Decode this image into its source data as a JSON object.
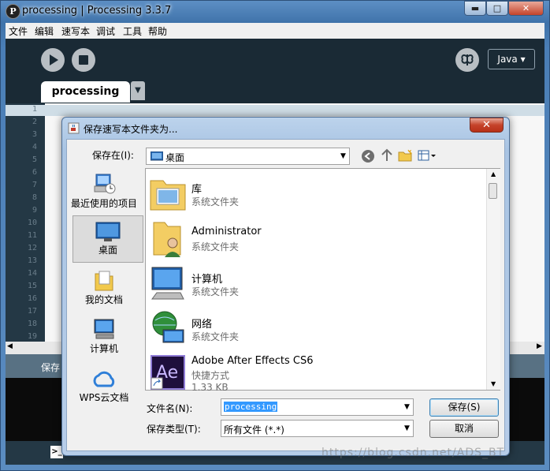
{
  "window": {
    "title": "processing | Processing 3.3.7",
    "app_icon_letter": "P",
    "minimize": "▬",
    "maximize": "□",
    "close": "✕"
  },
  "menu": [
    "文件",
    "编辑",
    "速写本",
    "调试",
    "工具",
    "帮助"
  ],
  "toolbar": {
    "mode_label": "Java ▾",
    "debug_glyph": "꙰"
  },
  "tab": {
    "label": "processing",
    "menu_arrow": "▼"
  },
  "line_numbers": [
    "1",
    "2",
    "3",
    "4",
    "5",
    "6",
    "7",
    "8",
    "9",
    "10",
    "11",
    "12",
    "13",
    "14",
    "15",
    "16",
    "17",
    "18",
    "19"
  ],
  "status_text": "保存",
  "dialog": {
    "title": "保存速写本文件夹为...",
    "close": "✕",
    "save_in_label": "保存在(I):",
    "save_in_value": "桌面",
    "places": [
      {
        "label": "最近使用的项目",
        "icon": "recent-icon"
      },
      {
        "label": "桌面",
        "icon": "desktop-icon"
      },
      {
        "label": "我的文档",
        "icon": "documents-icon"
      },
      {
        "label": "计算机",
        "icon": "computer-icon"
      },
      {
        "label": "WPS云文档",
        "icon": "cloud-icon"
      }
    ],
    "files": [
      {
        "name": "库",
        "type": "系统文件夹",
        "size": ""
      },
      {
        "name": "Administrator",
        "type": "系统文件夹",
        "size": ""
      },
      {
        "name": "计算机",
        "type": "系统文件夹",
        "size": ""
      },
      {
        "name": "网络",
        "type": "系统文件夹",
        "size": ""
      },
      {
        "name": "Adobe After Effects CS6",
        "type": "快捷方式",
        "size": "1.33 KB"
      }
    ],
    "filename_label": "文件名(N):",
    "filename_value": "processing",
    "filetype_label": "保存类型(T):",
    "filetype_value": "所有文件 (*.*)",
    "save_button": "保存(S)",
    "cancel_button": "取消"
  },
  "watermark": "https://blog.csdn.net/ADS_BT",
  "colors": {
    "editor_bg": "#1a2a35",
    "dialog_frame": "#b7cde8",
    "selection": "#3399ff"
  }
}
